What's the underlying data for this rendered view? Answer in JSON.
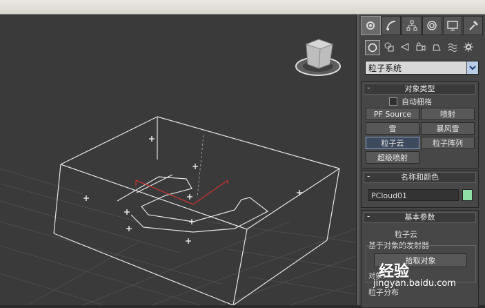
{
  "panel": {
    "dropdown_value": "粒子系统",
    "object_type": {
      "title": "对象类型",
      "autogrid": "自动栅格",
      "buttons": [
        "PF Source",
        "喷射",
        "雪",
        "暴风雪",
        "粒子云",
        "粒子阵列",
        "超级喷射"
      ]
    },
    "name_color": {
      "title": "名称和颜色",
      "name": "PCloud01",
      "color": "#8fe0a6"
    },
    "basic_params": {
      "title": "基本参数",
      "subtitle": "粒子云",
      "emitter_group": "基于对象的发射器",
      "pick_object": "拾取对象",
      "object_label": "对象：",
      "distribution": "粒子分布"
    }
  },
  "watermark": {
    "brand": "Baidu",
    "jingyan": "经验",
    "url": "jingyan.baidu.com"
  }
}
